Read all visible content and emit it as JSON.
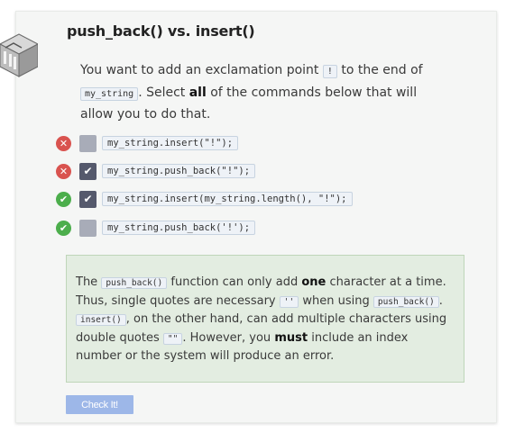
{
  "header": {
    "title": "push_back() vs. insert()"
  },
  "prompt": {
    "t1": "You want to add an exclamation point",
    "code1": "!",
    "t2": "to the end of",
    "code2": "my_string",
    "t3": ". Select",
    "bold": "all",
    "t4": "of the commands below that will allow you to do that."
  },
  "options": [
    {
      "code": "my_string.insert(\"!\");",
      "checked": false,
      "result": "incorrect",
      "result_icon": "x-icon"
    },
    {
      "code": "my_string.push_back(\"!\");",
      "checked": true,
      "result": "incorrect",
      "result_icon": "x-icon"
    },
    {
      "code": "my_string.insert(my_string.length(), \"!\");",
      "checked": true,
      "result": "correct",
      "result_icon": "check-icon"
    },
    {
      "code": "my_string.push_back('!');",
      "checked": false,
      "result": "correct",
      "result_icon": "check-icon"
    }
  ],
  "feedback": {
    "t1": "The",
    "c1": "push_back()",
    "t2": "function can only add",
    "b1": "one",
    "t3": "character at a time. Thus, single quotes are necessary",
    "c2": "''",
    "t4": "when using",
    "c3": "push_back()",
    "t5": ".",
    "c4": "insert()",
    "t6": ", on the other hand, can add multiple characters using double quotes",
    "c5": "\"\"",
    "t7": ". However, you",
    "b2": "must",
    "t8": "include an index number or the system will produce an error."
  },
  "actions": {
    "check_label": "Check It!"
  },
  "colors": {
    "wrong": "#d9534f",
    "right": "#4cae4c",
    "checkbox_checked": "#55596c",
    "checkbox_unchecked": "#a8acb8",
    "feedback_bg": "#e3ede1",
    "button_bg": "#9db7e8"
  }
}
